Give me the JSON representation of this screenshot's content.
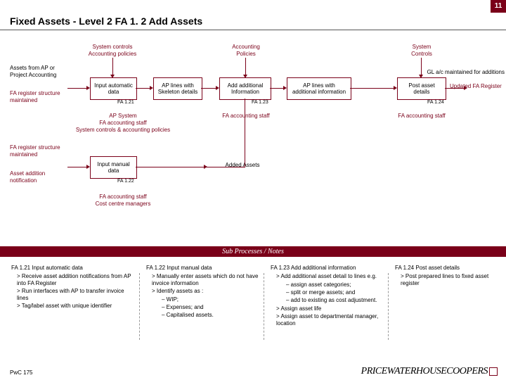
{
  "corner": "11",
  "header": "Fixed Assets - Level 2    FA 1. 2 Add Assets",
  "topLabels": {
    "c1": "System controls\nAccounting policies",
    "c2": "Accounting\nPolicies",
    "c3": "System\nControls"
  },
  "sideLabels": {
    "assetsFrom": "Assets from AP or\nProject Accounting",
    "faRegMaint1": "FA register structure\nmaintained",
    "glac": "GL a/c maintained for additions",
    "updatedFA": "Updated FA Register",
    "faRegMaint2": "FA register structure\nmaintained",
    "assetAddNotif": "Asset addition\nnotification",
    "addedAssets": "Added Assets"
  },
  "boxes": {
    "b1": "Input automatic\ndata",
    "b1code": "FA 1.21",
    "b2": "AP lines with\nSkeleton details",
    "b3": "Add additional\nInformation",
    "b3code": "FA 1.23",
    "b4": "AP lines with\nadditional information",
    "b5": "Post asset\ndetails",
    "b5code": "FA 1.24",
    "b6": "Input manual\ndata",
    "b6code": "FA 1.22"
  },
  "belowLabels": {
    "l1": "AP System\nFA accounting staff\nSystem controls & accounting policies",
    "l2": "FA accounting staff",
    "l3": "FA accounting staff",
    "l4": "FA accounting staff\nCost centre managers"
  },
  "subHeader": "Sub Processes / Notes",
  "notes": {
    "n1h": "FA 1.21  Input automatic data",
    "n1": [
      "Receive asset addition notifications from AP into FA Register",
      "Run interfaces with AP to transfer invoice lines",
      "Tag/label asset with unique identifier"
    ],
    "n2h": "FA 1.22  Input manual data",
    "n2": [
      "Manually enter assets which do not have invoice information",
      "Identify assets as :"
    ],
    "n2d": [
      "WIP;",
      "Expenses; and",
      "Capitalised assets."
    ],
    "n3h": "FA 1.23 Add additional information",
    "n3a": "Add additional asset detail to lines e.g.",
    "n3d": [
      "assign asset categories;",
      "split or merge assets; and",
      "add to existing as cost adjustment."
    ],
    "n3b": [
      "Assign asset life",
      "Assign asset to departmental manager, location"
    ],
    "n4h": "FA 1.24 Post asset details",
    "n4": [
      "Post prepared lines to fixed asset register"
    ]
  },
  "footer": "PwC 175",
  "logo": "PRICEWATERHOUSECOOPERS"
}
